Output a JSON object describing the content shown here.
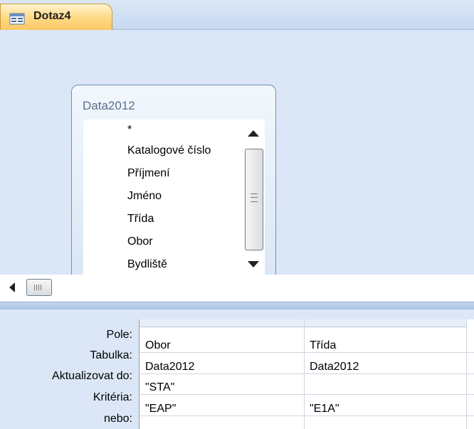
{
  "tab": {
    "title": "Dotaz4",
    "icon": "query-icon"
  },
  "table_window": {
    "title": "Data2012",
    "fields": [
      "*",
      "Katalogové číslo",
      "Příjmení",
      "Jméno",
      "Třída",
      "Obor",
      "Bydliště"
    ]
  },
  "qbe": {
    "row_labels": [
      "Pole:",
      "Tabulka:",
      "Aktualizovat do:",
      "Kritéria:",
      "nebo:"
    ],
    "columns": [
      {
        "pole": "Obor",
        "tabulka": "Data2012",
        "aktualizovat": "\"STA\"",
        "kriteria": "\"EAP\"",
        "nebo": ""
      },
      {
        "pole": "Třída",
        "tabulka": "Data2012",
        "aktualizovat": "",
        "kriteria": "\"E1A\"",
        "nebo": ""
      }
    ]
  },
  "colors": {
    "tab_gold": "#fbc765",
    "design_background": "#dbe7f6",
    "table_border": "#6f8fb7"
  }
}
